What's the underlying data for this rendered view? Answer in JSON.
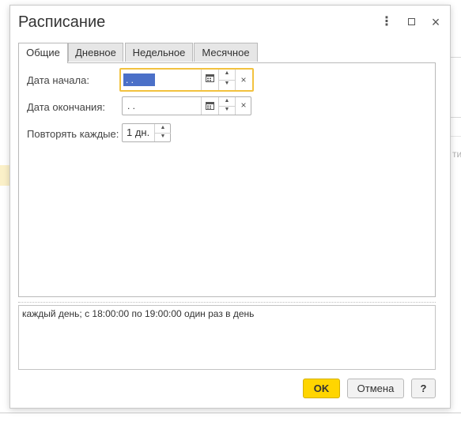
{
  "dialog": {
    "title": "Расписание",
    "more_icon_glyph": "⋮",
    "close_icon_glyph": "×"
  },
  "tabs": [
    {
      "label": "Общие",
      "active": true
    },
    {
      "label": "Дневное",
      "active": false
    },
    {
      "label": "Недельное",
      "active": false
    },
    {
      "label": "Месячное",
      "active": false
    }
  ],
  "general": {
    "start_date_label": "Дата начала:",
    "start_date_value": " .  .",
    "end_date_label": "Дата окончания:",
    "end_date_value": " .  .",
    "repeat_label": "Повторять каждые:",
    "repeat_value": "1 дн.",
    "clear_glyph": "×",
    "spin_up_glyph": "▲",
    "spin_down_glyph": "▼"
  },
  "summary": {
    "text": "каждый день; с 18:00:00 по 19:00:00 один раз в день"
  },
  "buttons": {
    "ok": "OK",
    "cancel": "Отмена",
    "help": "?"
  },
  "background": {
    "partial_text": "ти"
  },
  "colors": {
    "accent_yellow": "#ffd500",
    "focus_border": "#f2c23f",
    "selection_blue": "#4b70c8"
  }
}
